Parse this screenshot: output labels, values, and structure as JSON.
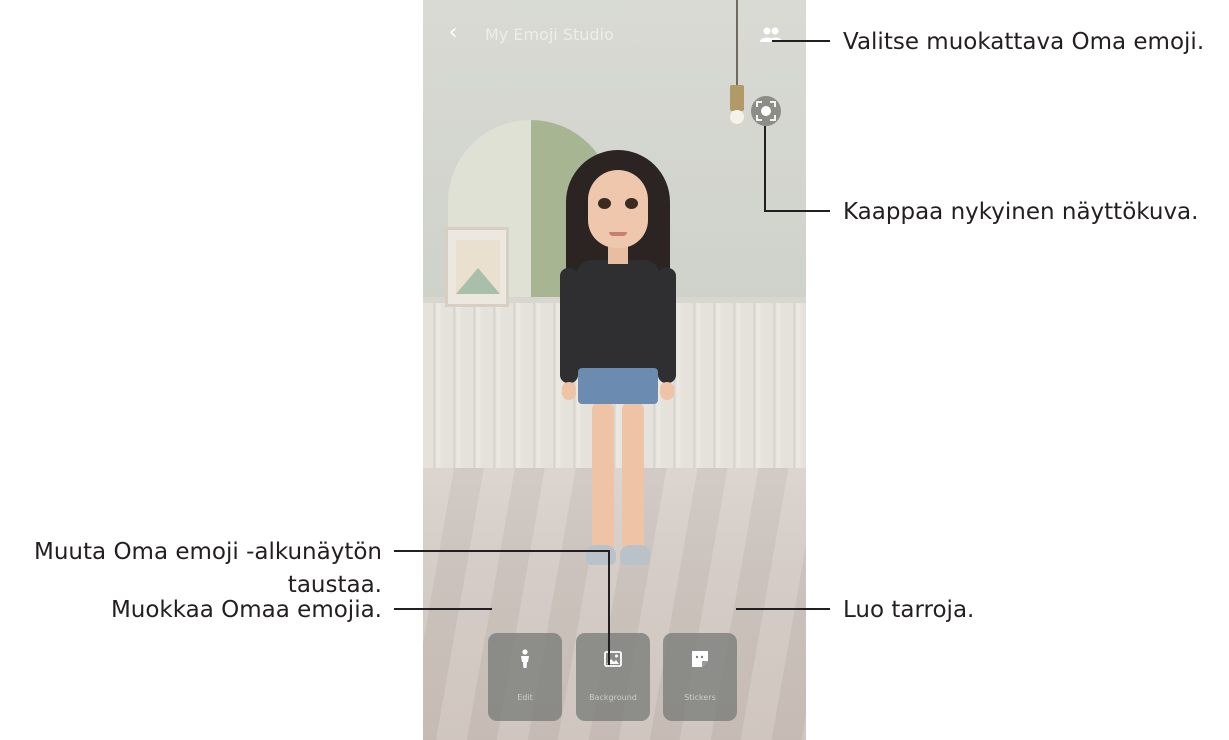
{
  "screen": {
    "title": "My Emoji Studio",
    "buttons": [
      {
        "label": "Edit"
      },
      {
        "label": "Background"
      },
      {
        "label": "Stickers"
      }
    ]
  },
  "callouts": {
    "select_emoji": "Valitse muokattava Oma emoji.",
    "capture": "Kaappaa nykyinen näyttökuva.",
    "background_line1": "Muuta Oma emoji -alkunäytön",
    "background_line2": "taustaa.",
    "edit": "Muokkaa Omaa emojia.",
    "stickers": "Luo tarroja."
  },
  "colors": {
    "text": "#231f20",
    "button_bg": "#7a7c7a"
  },
  "icons": [
    "back-icon",
    "switch-emoji-icon",
    "capture-icon",
    "edit-person-icon",
    "background-image-icon",
    "stickers-icon"
  ]
}
